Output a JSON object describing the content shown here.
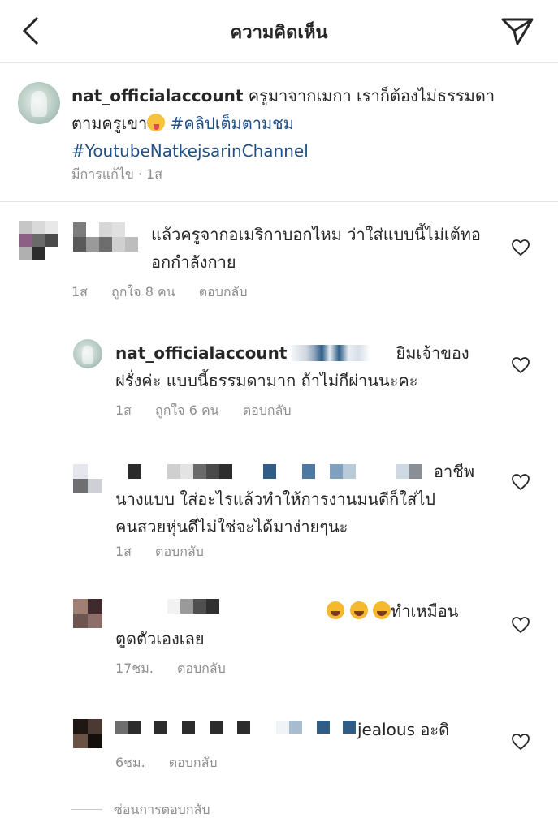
{
  "header": {
    "title": "ความคิดเห็น",
    "back_icon": "chevron-left-icon",
    "share_icon": "paper-plane-icon"
  },
  "caption": {
    "username": "nat_officialaccount",
    "text_1": "ครูมาจากเมกา เราก็ต้องไม่ธรรมดา",
    "text_2": "ตามครูเขา",
    "hashtag_1": "#คลิปเต็มตามชม",
    "hashtag_2": "#YoutubeNatkejsarinChannel",
    "edited": "มีการแก้ไข · 1ส"
  },
  "comments": [
    {
      "text": "แล้วครูจากอเมริกาบอกไหม ว่าใส่แบบนี้ไม่เต้ทออกกำลังกาย",
      "time": "1ส",
      "likes": "ถูกใจ 8 คน",
      "reply": "ตอบกลับ"
    },
    {
      "username": "nat_officialaccount",
      "text_1": "ยิมเจ้าของ",
      "text_2": "ฝรั่งค่ะ แบบนี้ธรรมดามาก ถ้าไม่กีผ่านนะคะ",
      "time": "1ส",
      "likes": "ถูกใจ 6 คน",
      "reply": "ตอบกลับ"
    },
    {
      "text_1": "อาชีพ",
      "text_2": "นางแบบ  ใส่อะไรแล้วทำให้การงานมนดีก็ใส่ไป",
      "text_3": "คนสวยหุ่นดีไม่ใช่จะได้มาง่ายๆนะ",
      "time": "1ส",
      "reply": "ตอบกลับ"
    },
    {
      "text_1": "ทำเหมือน",
      "text_2": "ตูดตัวเองเลย",
      "time": "17ชม.",
      "reply": "ตอบกลับ"
    },
    {
      "text_1": "jealous อะดิ",
      "time": "6ชม.",
      "reply": "ตอบกลับ"
    }
  ],
  "hide_replies": "ซ่อนการตอบกลับ",
  "colors": {
    "hashtag": "#1f4f87",
    "meta": "#8e8e8e",
    "divider": "#e4e4e4"
  }
}
